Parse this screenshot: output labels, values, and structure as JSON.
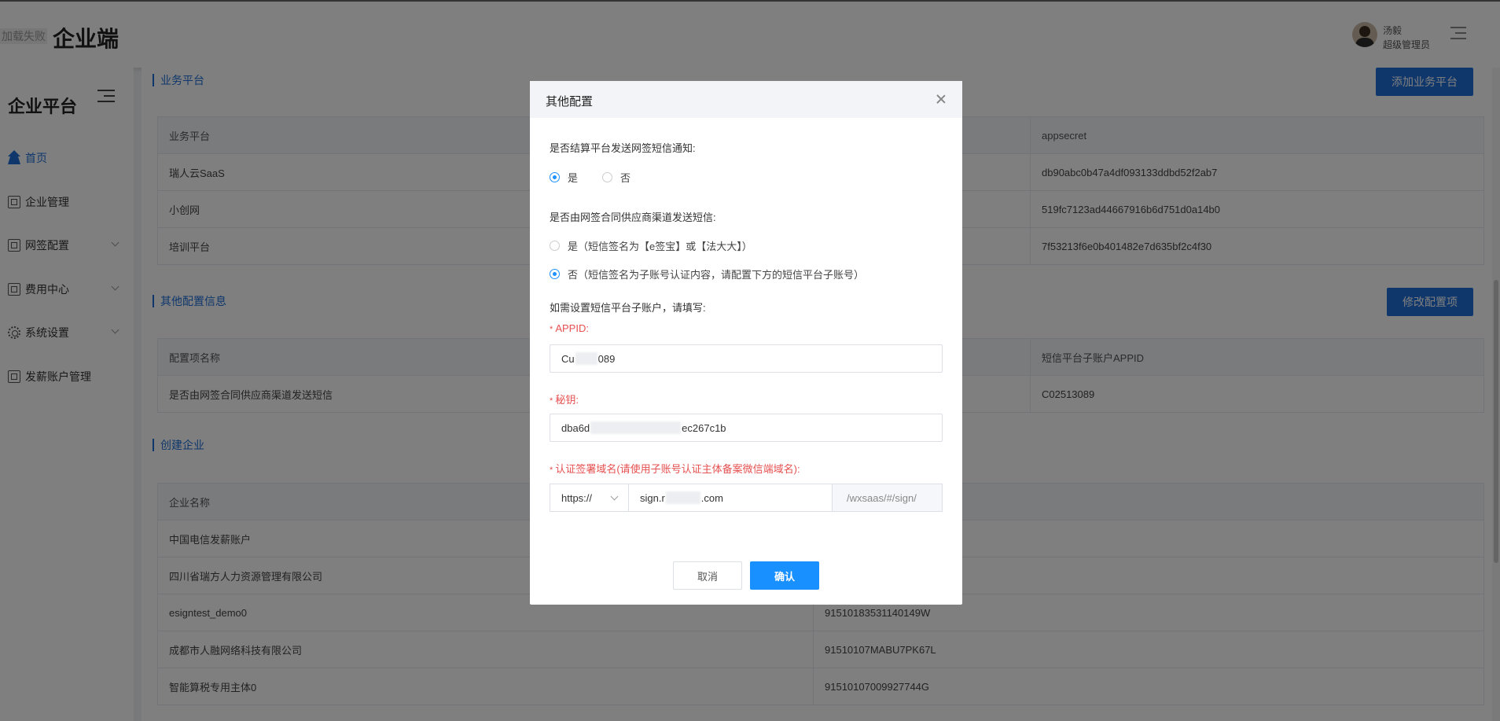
{
  "header": {
    "logo_fail_text": "加载失败",
    "brand": "企业端",
    "user_name": "汤毅",
    "user_role": "超级管理员"
  },
  "sidebar": {
    "title": "企业平台",
    "items": [
      {
        "label": "首页"
      },
      {
        "label": "企业管理"
      },
      {
        "label": "网签配置"
      },
      {
        "label": "费用中心"
      },
      {
        "label": "系统设置"
      },
      {
        "label": "发薪账户管理"
      }
    ]
  },
  "main": {
    "business": {
      "title": "业务平台",
      "add_button": "添加业务平台",
      "headers": [
        "业务平台",
        "appsecret"
      ],
      "rows": [
        [
          "瑞人云SaaS",
          "db90abc0b47a4df093133ddbd52f2ab7"
        ],
        [
          "小创网",
          "519fc7123ad44667916b6d751d0a14b0"
        ],
        [
          "培训平台",
          "7f53213f6e0b401482e7d635bf2c4f30"
        ]
      ]
    },
    "other_config": {
      "title": "其他配置信息",
      "edit_button": "修改配置项",
      "headers": [
        "配置项名称",
        "短信平台子账户APPID"
      ],
      "rows": [
        [
          "是否由网签合同供应商渠道发送短信",
          "C02513089"
        ]
      ]
    },
    "enterprise": {
      "title": "创建企业",
      "headers": [
        "企业名称",
        ""
      ],
      "rows": [
        [
          "中国电信发薪账户",
          ""
        ],
        [
          "四川省瑞方人力资源管理有限公司",
          ""
        ],
        [
          "esigntest_demo0",
          "91510183531140149W"
        ],
        [
          "成都市人融网络科技有限公司",
          "91510107MABU7PK67L"
        ],
        [
          "智能算税专用主体0",
          "91510107009927744G"
        ]
      ]
    }
  },
  "modal": {
    "title": "其他配置",
    "q1": "是否结算平台发送网签短信通知:",
    "q1_yes": "是",
    "q1_no": "否",
    "q2": "是否由网签合同供应商渠道发送短信:",
    "q2_yes": "是（短信签名为【e签宝】或【法大大】）",
    "q2_no": "否（短信签名为子账号认证内容，请配置下方的短信平台子账号）",
    "sub_hint": "如需设置短信平台子账户，请填写:",
    "appid_label": "APPID:",
    "appid_start": "Cu",
    "appid_end": "089",
    "secret_label": "秘钥:",
    "secret_start": "dba6d",
    "secret_end": "ec267c1b",
    "domain_label": "认证签署域名(请使用子账号认证主体备案微信端域名):",
    "protocol": "https://",
    "host_start": "sign.r",
    "host_end": ".com",
    "path_suffix": "/wxsaas/#/sign/",
    "cancel": "取消",
    "confirm": "确认"
  }
}
